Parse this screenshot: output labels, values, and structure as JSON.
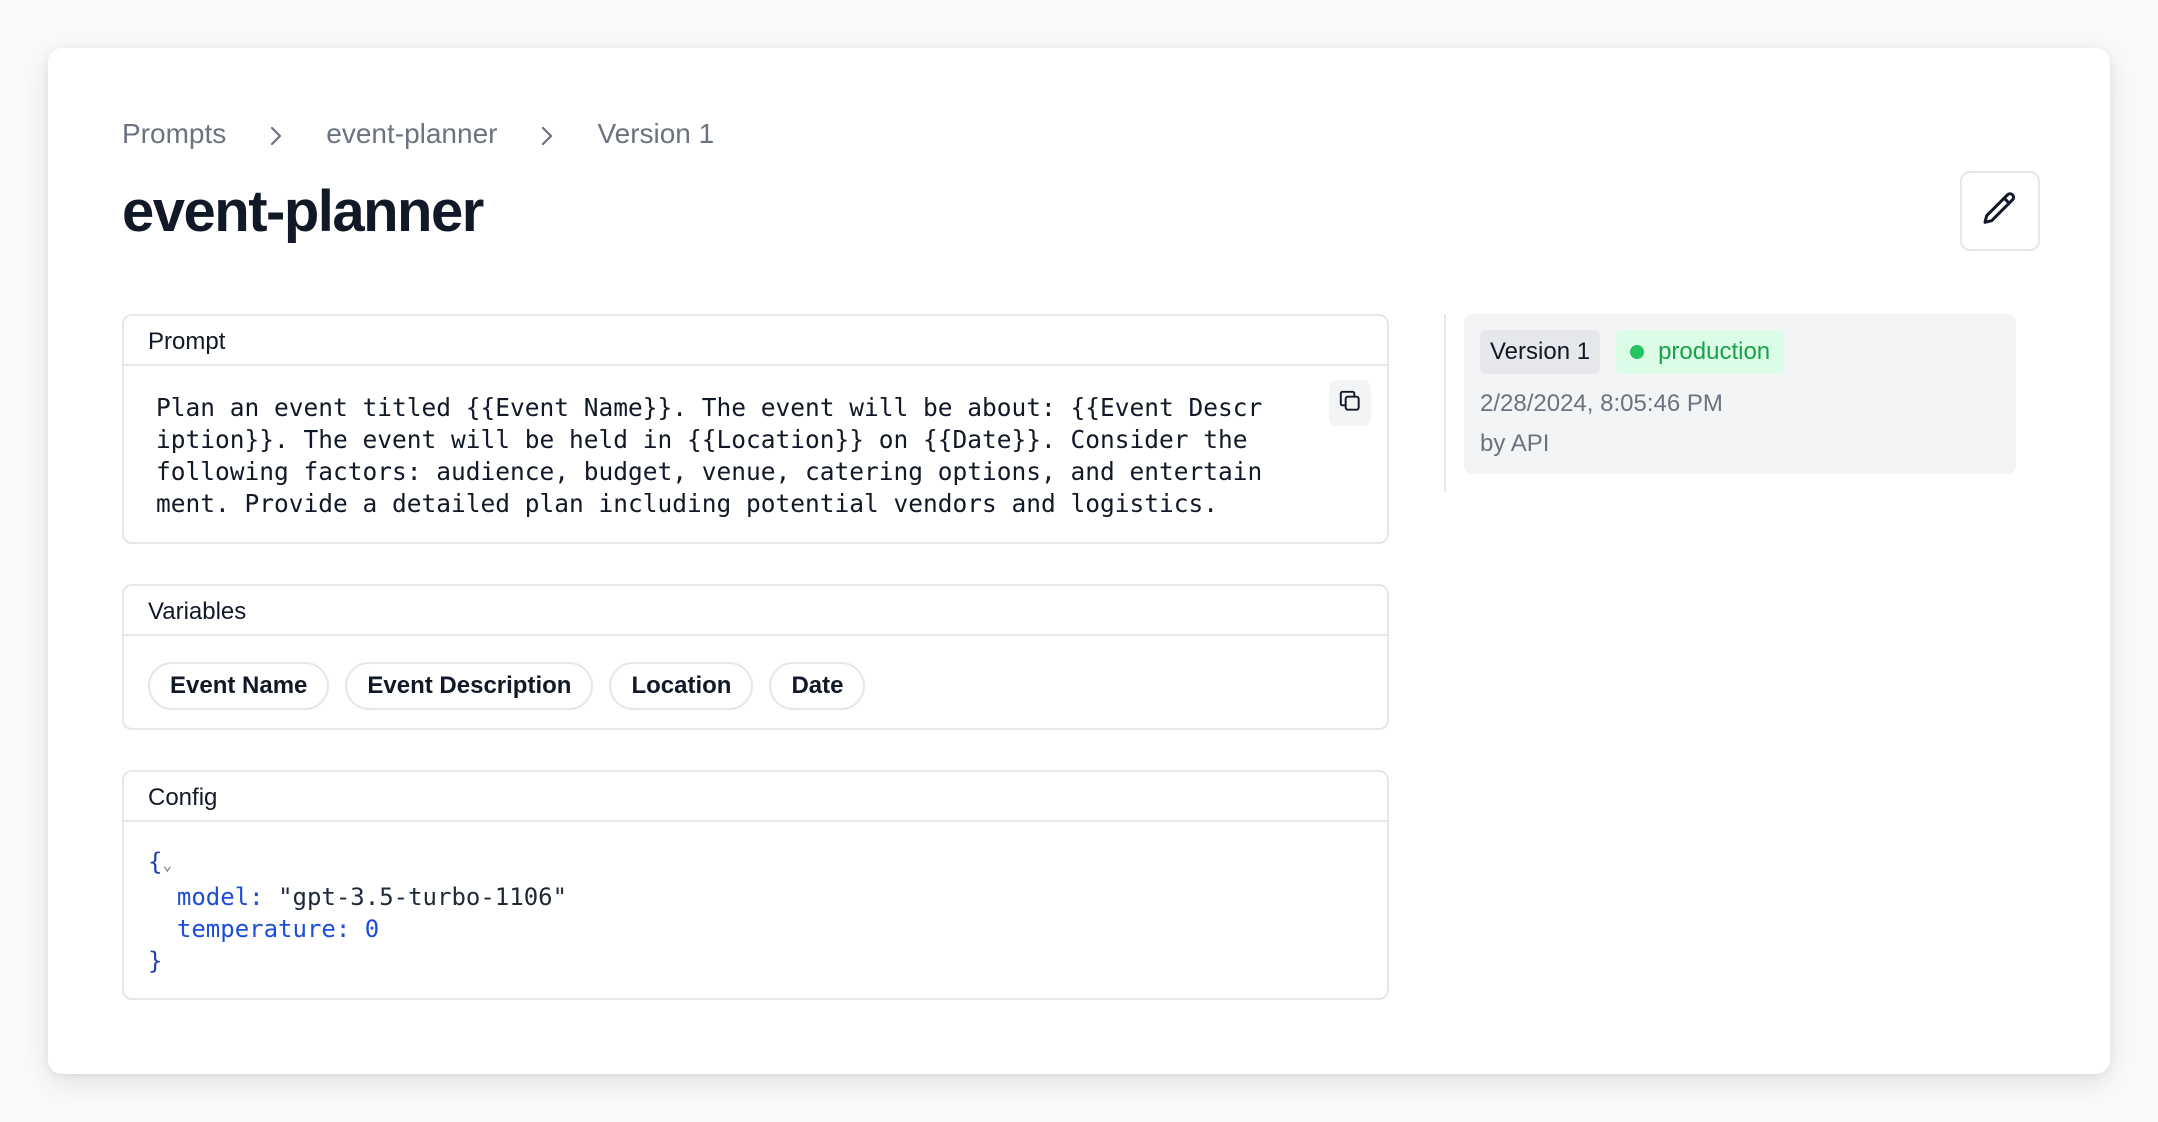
{
  "breadcrumb": {
    "items": [
      "Prompts",
      "event-planner",
      "Version 1"
    ]
  },
  "page": {
    "title": "event-planner",
    "edit_icon": "pencil-icon"
  },
  "prompt_panel": {
    "header": "Prompt",
    "text": "Plan an event titled {{Event Name}}. The event will be about: {{Event Description}}. The event will be held in {{Location}} on {{Date}}. Consider the following factors: audience, budget, venue, catering options, and entertainment. Provide a detailed plan including potential vendors and logistics.",
    "copy_icon": "copy-icon"
  },
  "variables_panel": {
    "header": "Variables",
    "items": [
      "Event Name",
      "Event Description",
      "Location",
      "Date"
    ]
  },
  "config_panel": {
    "header": "Config",
    "open_brace": "{",
    "close_brace": "}",
    "model_key": "model:",
    "model_value": "\"gpt-3.5-turbo-1106\"",
    "temperature_key": "temperature:",
    "temperature_value": "0"
  },
  "versions": [
    {
      "label": "Version 1",
      "badge": "production",
      "date": "2/28/2024, 8:05:46 PM",
      "author": "by API"
    }
  ],
  "colors": {
    "production_bg": "#dcfce7",
    "production_text": "#16a34a",
    "production_dot": "#22c55e",
    "json_key": "#1d4ed8"
  }
}
